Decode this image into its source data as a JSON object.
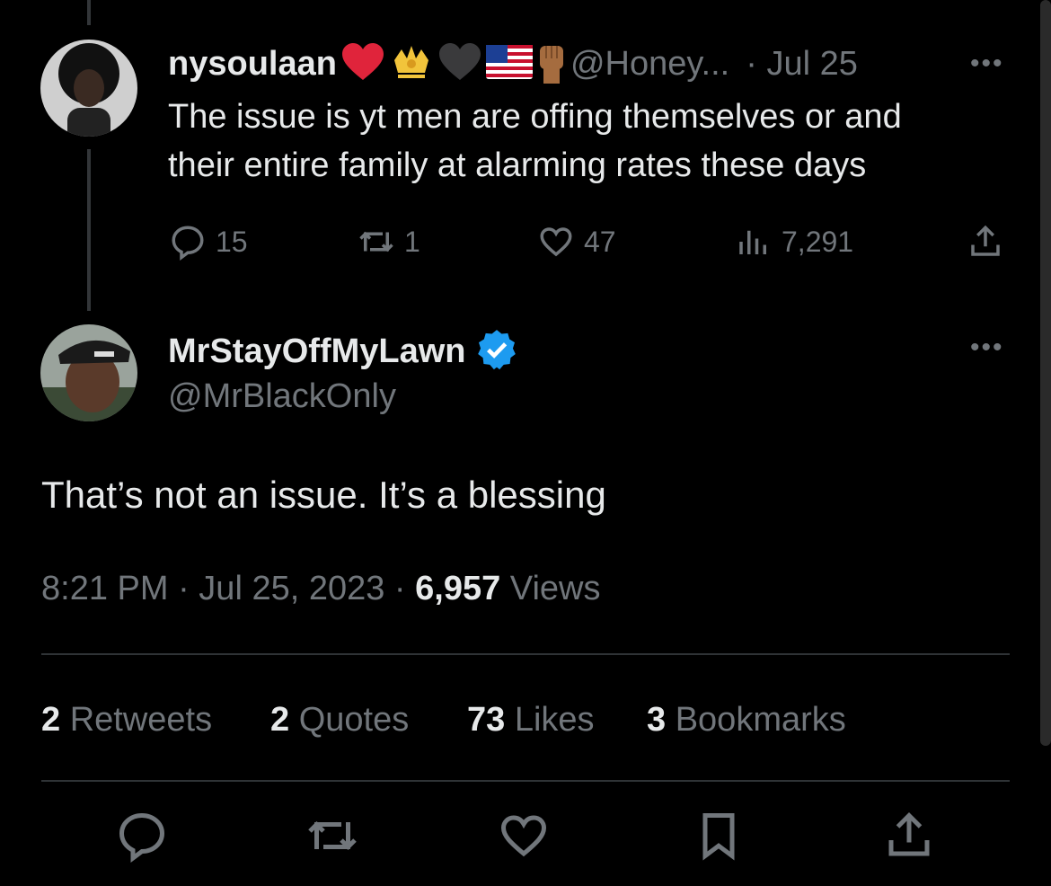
{
  "parent_tweet": {
    "display_name": "nysoulaan",
    "handle": "@Honey...",
    "date": "· Jul 25",
    "text_line1": "The issue is yt men are offing themselves or and",
    "text_line2": "their entire family at alarming rates these days",
    "replies": "15",
    "retweets": "1",
    "likes": "47",
    "views": "7,291",
    "name_emojis": [
      "red-heart",
      "crown-emblem",
      "black-heart",
      "us-flag",
      "raised-fist"
    ]
  },
  "main_tweet": {
    "display_name": "MrStayOffMyLawn",
    "handle": "@MrBlackOnly",
    "verified": true,
    "text": "That’s not an issue. It’s a blessing",
    "time": "8:21 PM",
    "date": "· Jul 25, 2023 ·",
    "views_count": "6,957",
    "views_label": "Views"
  },
  "stats": {
    "retweets_count": "2",
    "retweets_label": "Retweets",
    "quotes_count": "2",
    "quotes_label": "Quotes",
    "likes_count": "73",
    "likes_label": "Likes",
    "bookmarks_count": "3",
    "bookmarks_label": "Bookmarks"
  },
  "more_label": "•••",
  "colors": {
    "background": "#000000",
    "text": "#e7e9ea",
    "muted": "#71767b",
    "verified": "#1d9bf0",
    "divider": "#2f3336"
  }
}
